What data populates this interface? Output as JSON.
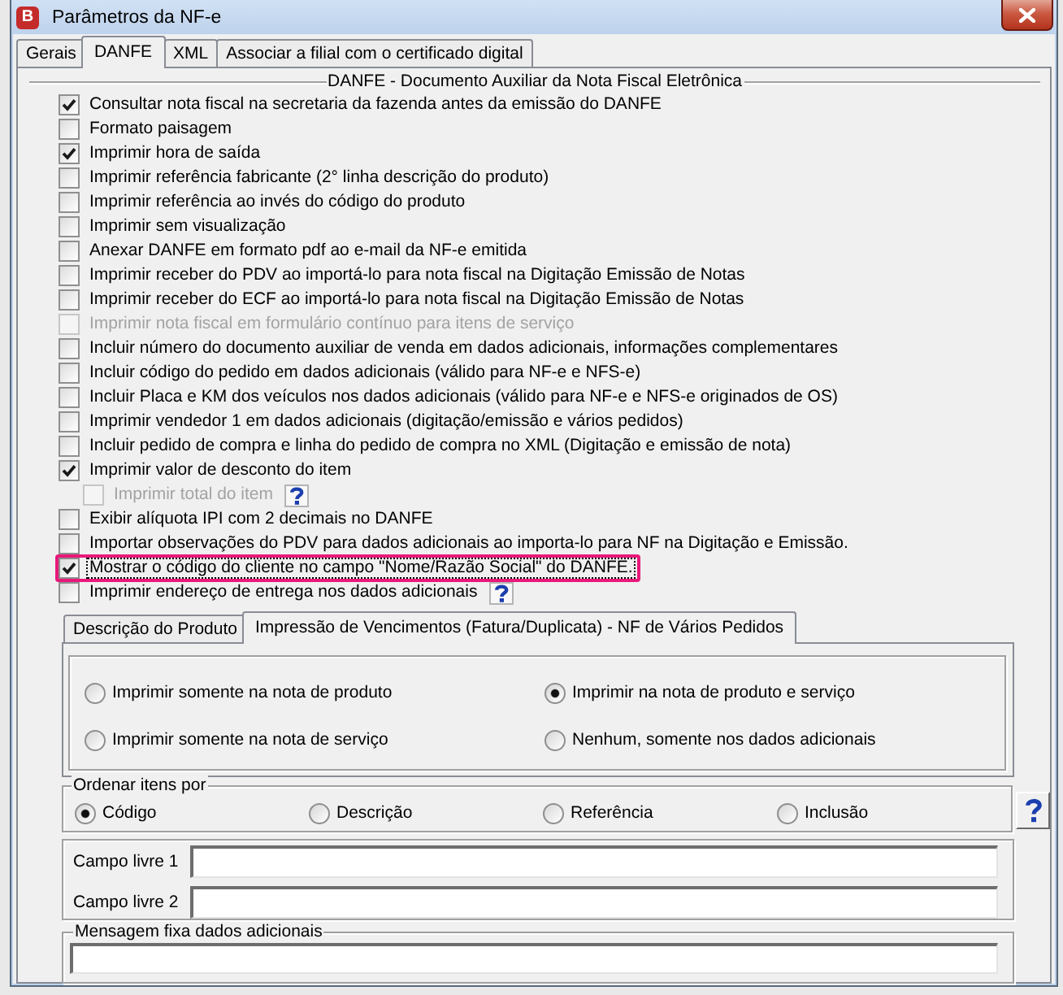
{
  "window": {
    "icon_letter": "B",
    "title": "Parâmetros da NF-e"
  },
  "tabs": [
    {
      "label": "Gerais",
      "selected": false
    },
    {
      "label": "DANFE",
      "selected": true
    },
    {
      "label": "XML",
      "selected": false
    },
    {
      "label": "Associar a filial com o certificado digital",
      "selected": false
    }
  ],
  "danfe_group": {
    "title": "DANFE - Documento Auxiliar da Nota Fiscal Eletrônica",
    "options": [
      {
        "label": "Consultar nota fiscal na secretaria da fazenda antes da emissão do DANFE",
        "checked": true,
        "disabled": false,
        "help": false,
        "focused": false,
        "highlighted": false
      },
      {
        "label": "Formato paisagem",
        "checked": false,
        "disabled": false,
        "help": false,
        "focused": false,
        "highlighted": false
      },
      {
        "label": "Imprimir hora de saída",
        "checked": true,
        "disabled": false,
        "help": false,
        "focused": false,
        "highlighted": false
      },
      {
        "label": "Imprimir referência fabricante (2° linha descrição do produto)",
        "checked": false,
        "disabled": false,
        "help": false,
        "focused": false,
        "highlighted": false
      },
      {
        "label": "Imprimir referência ao invés do código do produto",
        "checked": false,
        "disabled": false,
        "help": false,
        "focused": false,
        "highlighted": false
      },
      {
        "label": "Imprimir sem visualização",
        "checked": false,
        "disabled": false,
        "help": false,
        "focused": false,
        "highlighted": false
      },
      {
        "label": "Anexar DANFE em formato pdf ao e-mail da NF-e emitida",
        "checked": false,
        "disabled": false,
        "help": false,
        "focused": false,
        "highlighted": false
      },
      {
        "label": "Imprimir receber do PDV ao importá-lo para nota fiscal na Digitação Emissão de Notas",
        "checked": false,
        "disabled": false,
        "help": false,
        "focused": false,
        "highlighted": false
      },
      {
        "label": "Imprimir receber do ECF ao importá-lo para nota fiscal na Digitação Emissão de Notas",
        "checked": false,
        "disabled": false,
        "help": false,
        "focused": false,
        "highlighted": false
      },
      {
        "label": "Imprimir nota fiscal em formulário contínuo para itens de serviço",
        "checked": false,
        "disabled": true,
        "help": false,
        "focused": false,
        "highlighted": false
      },
      {
        "label": "Incluir número do documento auxiliar de venda em dados adicionais, informações complementares",
        "checked": false,
        "disabled": false,
        "help": false,
        "focused": false,
        "highlighted": false
      },
      {
        "label": "Incluir código do pedido em dados adicionais (válido para NF-e e NFS-e)",
        "checked": false,
        "disabled": false,
        "help": false,
        "focused": false,
        "highlighted": false
      },
      {
        "label": "Incluir Placa e KM dos veículos nos dados adicionais (válido para NF-e e NFS-e originados de OS)",
        "checked": false,
        "disabled": false,
        "help": false,
        "focused": false,
        "highlighted": false
      },
      {
        "label": "Imprimir vendedor 1 em dados adicionais (digitação/emissão e vários pedidos)",
        "checked": false,
        "disabled": false,
        "help": false,
        "focused": false,
        "highlighted": false
      },
      {
        "label": "Incluir pedido de compra e linha do pedido de compra no XML (Digitação e emissão de nota)",
        "checked": false,
        "disabled": false,
        "help": false,
        "focused": false,
        "highlighted": false
      },
      {
        "label": "Imprimir valor de desconto do item",
        "checked": true,
        "disabled": false,
        "help": false,
        "focused": false,
        "highlighted": false,
        "children": [
          {
            "label": "Imprimir total do item",
            "checked": false,
            "disabled": true,
            "help": true,
            "focused": false,
            "highlighted": false
          }
        ]
      },
      {
        "label": "Exibir alíquota IPI com 2 decimais no DANFE",
        "checked": false,
        "disabled": false,
        "help": false,
        "focused": false,
        "highlighted": false
      },
      {
        "label": "Importar observações do PDV para dados adicionais ao importa-lo para NF na Digitação e Emissão.",
        "checked": false,
        "disabled": false,
        "help": false,
        "focused": false,
        "highlighted": false
      },
      {
        "label": "Mostrar o código do cliente no campo \"Nome/Razão Social\" do DANFE.",
        "checked": true,
        "disabled": false,
        "help": false,
        "focused": true,
        "highlighted": true
      },
      {
        "label": "Imprimir endereço de entrega nos dados adicionais",
        "checked": false,
        "disabled": false,
        "help": true,
        "focused": false,
        "highlighted": false
      }
    ]
  },
  "sub_tabs": [
    {
      "label": "Descrição do Produto",
      "selected": false
    },
    {
      "label": "Impressão de Vencimentos (Fatura/Duplicata) - NF de Vários Pedidos",
      "selected": true
    }
  ],
  "vencimentos_options": [
    {
      "label": "Imprimir somente na nota de produto",
      "selected": false
    },
    {
      "label": "Imprimir na nota de produto e serviço",
      "selected": true
    },
    {
      "label": "Imprimir somente na nota de serviço",
      "selected": false
    },
    {
      "label": "Nenhum, somente nos dados adicionais",
      "selected": false
    }
  ],
  "sort_group": {
    "title": "Ordenar itens por",
    "help": true,
    "options": [
      {
        "label": "Código",
        "selected": true
      },
      {
        "label": "Descrição",
        "selected": false
      },
      {
        "label": "Referência",
        "selected": false
      },
      {
        "label": "Inclusão",
        "selected": false
      }
    ]
  },
  "free_fields": [
    {
      "label": "Campo livre 1"
    },
    {
      "label": "Campo livre 2"
    }
  ],
  "fixed_message": {
    "title": "Mensagem fixa dados adicionais"
  }
}
